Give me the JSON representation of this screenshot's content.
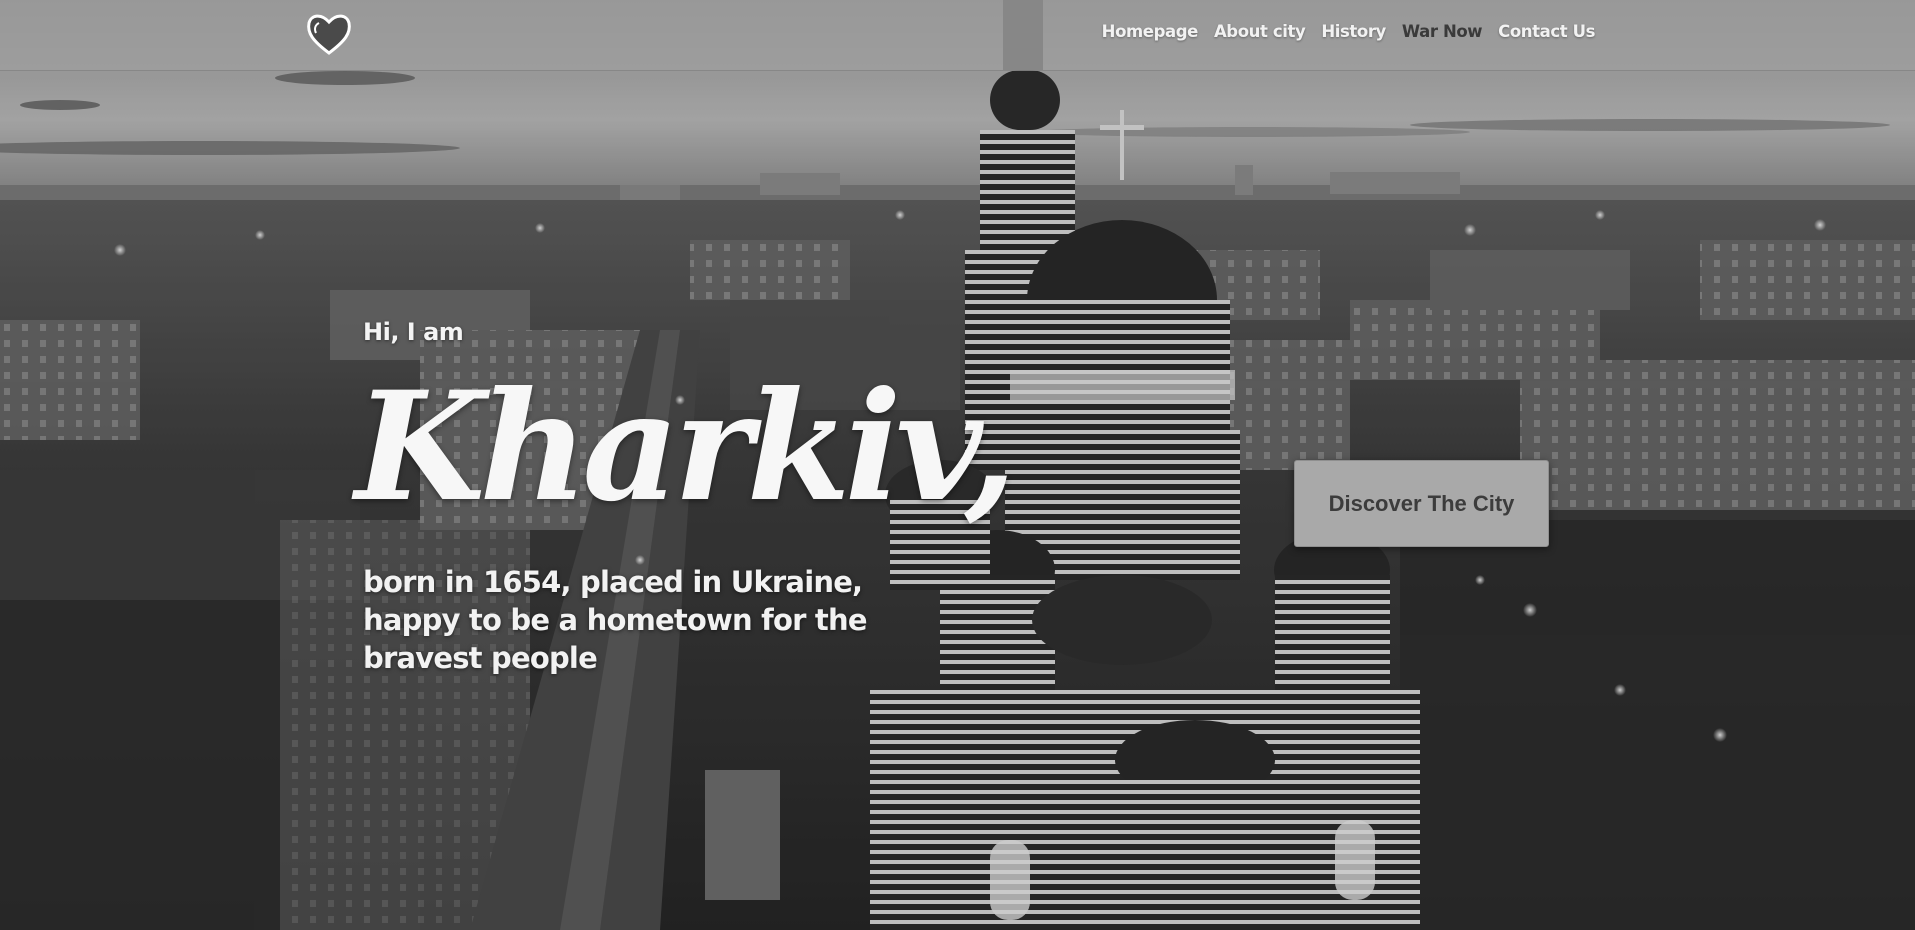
{
  "header": {
    "nav": [
      {
        "label": "Homepage"
      },
      {
        "label": "About city"
      },
      {
        "label": "History"
      },
      {
        "label": "War Now"
      },
      {
        "label": "Contact Us"
      }
    ],
    "active_nav": "War Now"
  },
  "hero": {
    "greeting": "Hi, I am",
    "title": "Kharkiv,",
    "tagline_lines": [
      "born in 1654, placed in Ukraine,",
      "happy to be a hometown for the",
      "bravest people"
    ],
    "cta_label": "Discover The City"
  },
  "icons": {
    "logo": "heart-icon"
  },
  "colors": {
    "header_bg": "#a0a0a0",
    "nav_text": "#f2f2f2",
    "nav_active": "#3a3a3a",
    "hero_text": "#f7f7f7",
    "cta_bg": "#a9a9a9",
    "cta_text": "#3c3c3c"
  }
}
